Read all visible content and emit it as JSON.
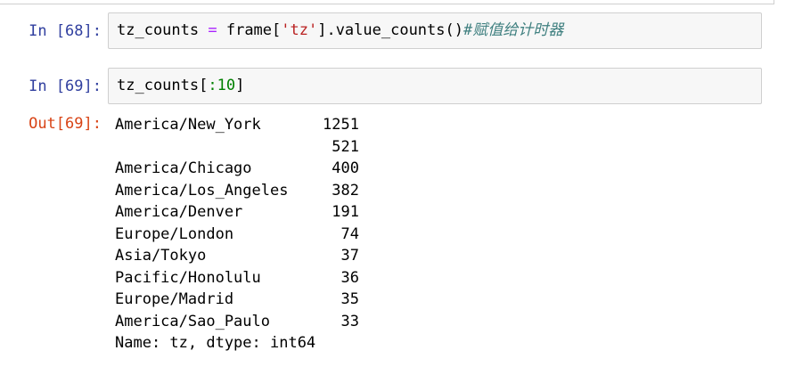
{
  "cells": [
    {
      "prompt": "In [68]:",
      "code": {
        "var": "tz_counts",
        "eq": " = ",
        "frame": "frame[",
        "str": "'tz'",
        "rest": "].value_counts()",
        "comment": "#赋值给计时器"
      }
    },
    {
      "prompt": "In [69]:",
      "code": {
        "var": "tz_counts[",
        "slice": ":10",
        "close": "]"
      }
    }
  ],
  "output": {
    "prompt": "Out[69]:",
    "rows": [
      {
        "label": "America/New_York",
        "value": "1251"
      },
      {
        "label": "",
        "value": "521"
      },
      {
        "label": "America/Chicago",
        "value": "400"
      },
      {
        "label": "America/Los_Angeles",
        "value": "382"
      },
      {
        "label": "America/Denver",
        "value": "191"
      },
      {
        "label": "Europe/London",
        "value": "74"
      },
      {
        "label": "Asia/Tokyo",
        "value": "37"
      },
      {
        "label": "Pacific/Honolulu",
        "value": "36"
      },
      {
        "label": "Europe/Madrid",
        "value": "35"
      },
      {
        "label": "America/Sao_Paulo",
        "value": "33"
      }
    ],
    "footer": "Name: tz, dtype: int64"
  }
}
